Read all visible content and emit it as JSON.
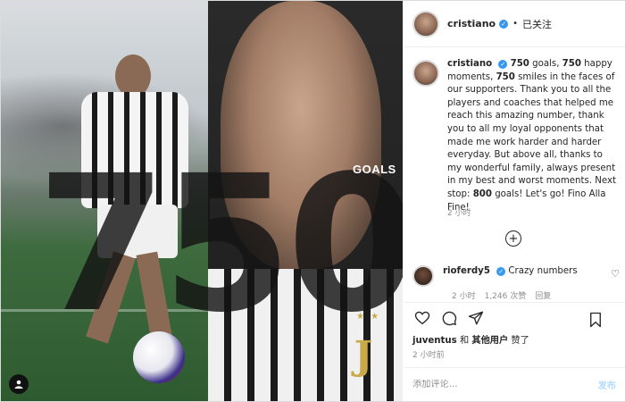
{
  "media": {
    "big_number": "750",
    "goals_word": "GOALS",
    "logo_letter": "J",
    "stars": "★ ★",
    "account_icon": "user-tag-icon"
  },
  "header": {
    "username": "cristiano",
    "follow_state": "已关注",
    "separator": "•"
  },
  "caption": {
    "username": "cristiano",
    "segments": [
      {
        "text": "750",
        "bold": true
      },
      {
        "text": " goals, ",
        "bold": false
      },
      {
        "text": "750",
        "bold": true
      },
      {
        "text": " happy moments, ",
        "bold": false
      },
      {
        "text": "750",
        "bold": true
      },
      {
        "text": " smiles in the faces of our supporters. Thank you to all the players and coaches that helped me reach this amazing number, thank you to all my loyal opponents that made me work harder and harder everyday. But above all, thanks to my wonderful family, always present in my best and worst moments. Next stop: ",
        "bold": false
      },
      {
        "text": "800",
        "bold": true
      },
      {
        "text": " goals! Let's go! Fino Alla Fine!",
        "bold": false
      }
    ],
    "time": "2 小时"
  },
  "comment": {
    "username": "rioferdy5",
    "text": "Crazy numbers",
    "time": "2 小时",
    "likes": "1,246 次赞",
    "reply": "回复"
  },
  "likes_line": {
    "user": "juventus",
    "middle": " 和 ",
    "others": "其他用户",
    "suffix": " 赞了"
  },
  "post_time": "2 小时前",
  "comment_box": {
    "placeholder": "添加评论...",
    "post_label": "发布"
  },
  "colors": {
    "verified": "#3897f0",
    "muted": "#8e8e8e",
    "post_disabled": "#b3dbff",
    "logo_gold": "#c9a94a"
  }
}
